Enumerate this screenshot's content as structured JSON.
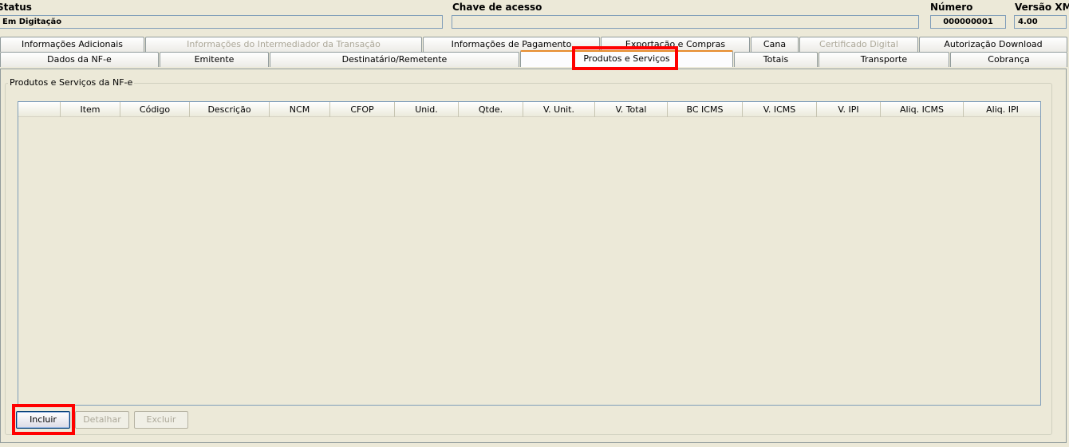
{
  "header": {
    "status_label": "Status",
    "status_value": "Em Digitação",
    "chave_label": "Chave de acesso",
    "chave_value": "",
    "numero_label": "Número",
    "numero_value": "000000001",
    "versao_label": "Versão XML",
    "versao_value": "4.00"
  },
  "tabs_row1": [
    {
      "label": "Informações Adicionais",
      "enabled": true
    },
    {
      "label": "Informações do Intermediador da Transação",
      "enabled": false
    },
    {
      "label": "Informações de Pagamento",
      "enabled": true
    },
    {
      "label": "Exportação e Compras",
      "enabled": true
    },
    {
      "label": "Cana",
      "enabled": true
    },
    {
      "label": "Certificado Digital",
      "enabled": false
    },
    {
      "label": "Autorização Download",
      "enabled": true
    }
  ],
  "tabs_row2": [
    {
      "label": "Dados da NF-e",
      "enabled": true
    },
    {
      "label": "Emitente",
      "enabled": true
    },
    {
      "label": "Destinatário/Remetente",
      "enabled": true
    },
    {
      "label": "Produtos e Serviços",
      "enabled": true,
      "active": true
    },
    {
      "label": "Totais",
      "enabled": true
    },
    {
      "label": "Transporte",
      "enabled": true
    },
    {
      "label": "Cobrança",
      "enabled": true
    }
  ],
  "group": {
    "title": "Produtos e Serviços da NF-e"
  },
  "table": {
    "columns": [
      "",
      "Item",
      "Código",
      "Descrição",
      "NCM",
      "CFOP",
      "Unid.",
      "Qtde.",
      "V. Unit.",
      "V. Total",
      "BC ICMS",
      "V. ICMS",
      "V. IPI",
      "Aliq. ICMS",
      "Aliq. IPI"
    ],
    "rows": []
  },
  "buttons": {
    "incluir": "Incluir",
    "detalhar": "Detalhar",
    "excluir": "Excluir"
  },
  "colors": {
    "background": "#ece9d8",
    "highlight": "#ff0000",
    "active_tab_accent": "#e68b2c",
    "disabled_text": "#aca899"
  }
}
